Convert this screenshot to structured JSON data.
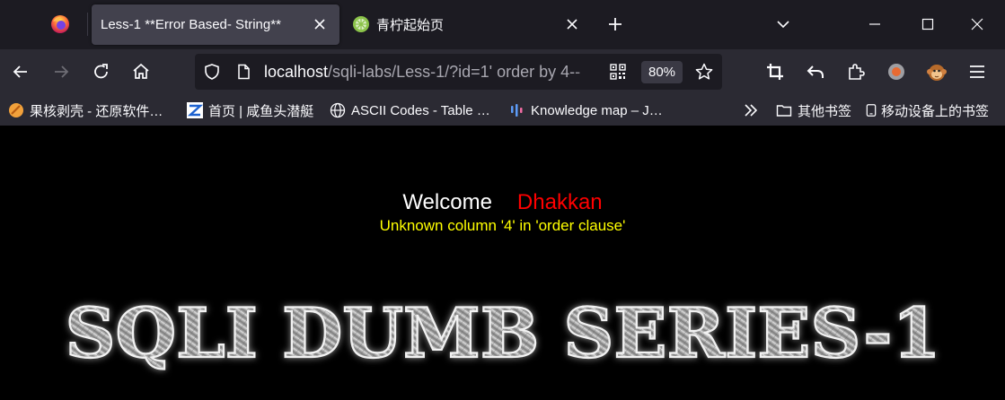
{
  "browser": {
    "tabs": [
      {
        "title": "Less-1 **Error Based- String**",
        "active": true
      },
      {
        "title": "青柠起始页",
        "active": false
      }
    ],
    "address_bar": {
      "host": "localhost",
      "path": "/sqli-labs/Less-1/?id=1' order by 4--",
      "zoom": "80%"
    },
    "bookmarks": [
      {
        "label": "果核剥壳 - 还原软件…",
        "icon": "orange-circle-icon"
      },
      {
        "label": "首页 | 咸鱼头潜艇",
        "icon": "z-logo-icon"
      },
      {
        "label": "ASCII Codes - Table …",
        "icon": "globe-icon"
      },
      {
        "label": "Knowledge map – J…",
        "icon": "bars-logo-icon"
      },
      {
        "label": "其他书签",
        "icon": "folder-icon"
      },
      {
        "label": "移动设备上的书签",
        "icon": "mobile-icon"
      }
    ]
  },
  "page": {
    "welcome": "Welcome",
    "name": "Dhakkan",
    "error": "Unknown column '4' in 'order clause'",
    "banner": "SQLI DUMB SERIES-1"
  },
  "colors": {
    "chrome_bg": "#1c1b22",
    "toolbar_bg": "#2b2a33",
    "active_tab": "#42414d",
    "page_bg": "#000000",
    "name_color": "#ff0000",
    "error_color": "#ffff00"
  }
}
